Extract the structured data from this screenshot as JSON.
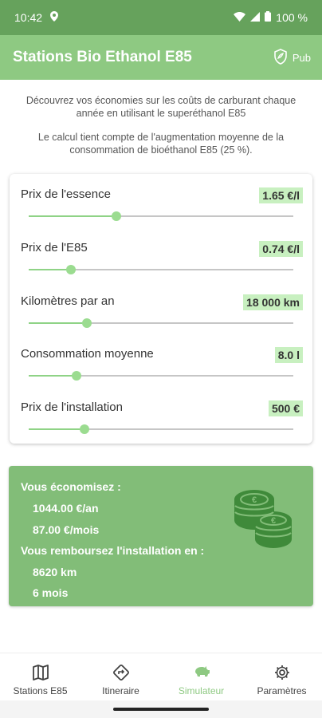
{
  "status_bar": {
    "time": "10:42",
    "battery": "100 %"
  },
  "app_bar": {
    "title": "Stations Bio Ethanol E85",
    "pub_label": "Pub"
  },
  "intro": {
    "line1": "Découvrez vos économies sur les coûts de carburant chaque année en utilisant le superéthanol E85",
    "line2": "Le calcul tient compte de l'augmentation moyenne de la consommation de bioéthanol E85 (25 %)."
  },
  "params": [
    {
      "label": "Prix de l'essence",
      "value": "1.65 €/l",
      "level": 0.33
    },
    {
      "label": "Prix de l'E85",
      "value": "0.74 €/l",
      "level": 0.16
    },
    {
      "label": "Kilomètres par an",
      "value": "18 000 km",
      "level": 0.22
    },
    {
      "label": "Consommation moyenne",
      "value": "8.0 l",
      "level": 0.18
    },
    {
      "label": "Prix de l'installation",
      "value": "500 €",
      "level": 0.21
    }
  ],
  "savings": {
    "heading": "Vous économisez :",
    "per_year": "1044.00 €/an",
    "per_month": "87.00 €/mois",
    "payback_heading": "Vous remboursez l'installation en :",
    "payback_km": "8620 km",
    "payback_months": "6 mois"
  },
  "nav": [
    {
      "label": "Stations E85",
      "icon": "map-icon"
    },
    {
      "label": "Itineraire",
      "icon": "directions-icon"
    },
    {
      "label": "Simulateur",
      "icon": "piggy-bank-icon",
      "active": true
    },
    {
      "label": "Paramètres",
      "icon": "gear-icon"
    }
  ],
  "colors": {
    "status": "#66a25c",
    "appbar": "#8ec982",
    "card_green": "#82bd78",
    "highlight": "#c8f0c0"
  }
}
